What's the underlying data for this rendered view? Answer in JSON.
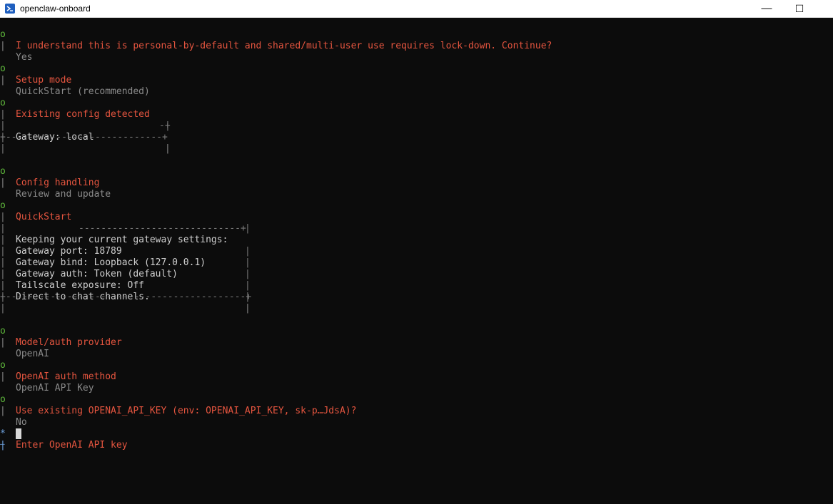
{
  "window": {
    "title": "openclaw-onboard",
    "minimize_glyph": "—",
    "maximize_glyph": "☐",
    "app_icon": "powershell-icon"
  },
  "terminal": {
    "security_prompt": "I understand this is personal-by-default and shared/multi-user use requires lock-down. Continue?",
    "security_answer": "Yes",
    "setup_mode_title": "Setup mode",
    "setup_mode_value": "QuickStart (recommended)",
    "existing_config_title": "Existing config detected",
    "existing_config_gateway": "Gateway: local",
    "config_handling_title": "Config handling",
    "config_handling_value": "Review and update",
    "quickstart_title": "QuickStart",
    "quickstart_lines": [
      "Keeping your current gateway settings:",
      "Gateway port: 18789",
      "Gateway bind: Loopback (127.0.0.1)",
      "Gateway auth: Token (default)",
      "Tailscale exposure: Off",
      "Direct to chat channels."
    ],
    "provider_title": "Model/auth provider",
    "provider_value": "OpenAI",
    "auth_method_title": "OpenAI auth method",
    "auth_method_value": "OpenAI API Key",
    "use_existing_title": "Use existing OPENAI_API_KEY (env: OPENAI_API_KEY, sk-p…JdsA)?",
    "use_existing_value": "No",
    "enter_key_title": "Enter OpenAI API key",
    "enter_key_value": "",
    "gutter_done": "o",
    "gutter_active": "*",
    "gutter_pipe": "|"
  },
  "colors": {
    "background": "#0c0c0c",
    "step_marker": "#5fb83c",
    "heading": "#e5553f",
    "answer": "#8a8a8a",
    "text": "#cfcfcf",
    "active": "#6fa3e0"
  }
}
